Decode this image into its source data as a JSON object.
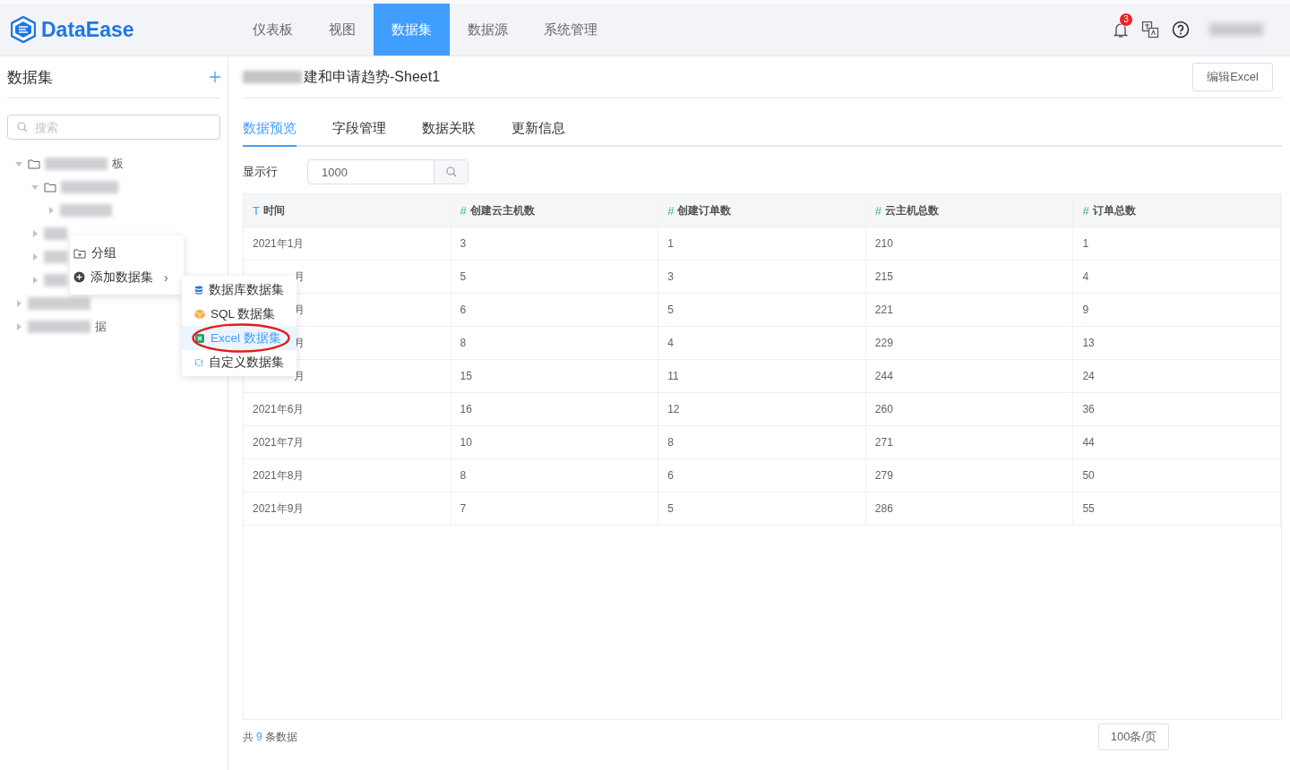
{
  "header": {
    "logo": "DataEase",
    "nav": [
      {
        "label": "仪表板",
        "selected": false
      },
      {
        "label": "视图",
        "selected": false
      },
      {
        "label": "数据集",
        "selected": true
      },
      {
        "label": "数据源",
        "selected": false
      },
      {
        "label": "系统管理",
        "selected": false
      }
    ],
    "notification_count": "3"
  },
  "sidebar": {
    "title": "数据集",
    "search": {
      "placeholder": "搜索"
    },
    "tree": [
      {
        "kind": "folder",
        "expanded": true,
        "label": "板",
        "children": [
          {
            "kind": "folder",
            "expanded": true,
            "children": [
              {
                "expanded": false
              }
            ]
          },
          {
            "expanded": false
          },
          {
            "expanded": false
          },
          {
            "expanded": false
          }
        ]
      },
      {
        "expanded": false
      },
      {
        "expanded": false,
        "label": "据"
      }
    ]
  },
  "context_menu": {
    "items": [
      {
        "kind": "group",
        "label": "分组"
      },
      {
        "kind": "add",
        "label": "添加数据集",
        "arrow": "›"
      }
    ],
    "submenu": [
      {
        "kind": "database",
        "label": "数据库数据集",
        "selected": false,
        "circled": false
      },
      {
        "kind": "sql",
        "label": "SQL 数据集",
        "selected": false,
        "circled": false
      },
      {
        "kind": "excel",
        "label": "Excel 数据集",
        "selected": true,
        "circled": true
      },
      {
        "kind": "custom",
        "label": "自定义数据集",
        "selected": false,
        "circled": false
      }
    ]
  },
  "main": {
    "title": "建和申请趋势-Sheet1",
    "edit_button": "编辑Excel",
    "tabs": [
      {
        "label": "数据预览",
        "selected": true
      },
      {
        "label": "字段管理",
        "selected": false
      },
      {
        "label": "数据关联",
        "selected": false
      },
      {
        "label": "更新信息",
        "selected": false
      }
    ],
    "row_limit": {
      "label": "显示行",
      "value": "1000"
    },
    "table": {
      "columns": [
        {
          "kind": "text",
          "mark": "T",
          "name": "时间"
        },
        {
          "kind": "number",
          "mark": "#",
          "name": "创建云主机数"
        },
        {
          "kind": "number",
          "mark": "#",
          "name": "创建订单数"
        },
        {
          "kind": "number",
          "mark": "#",
          "name": "云主机总数"
        },
        {
          "kind": "number",
          "mark": "#",
          "name": "订单总数"
        }
      ],
      "rows": [
        {
          "partial": false,
          "cells": [
            "2021年1月",
            "3",
            "1",
            "210",
            "1"
          ]
        },
        {
          "partial": true,
          "cells": [
            "月",
            "5",
            "3",
            "215",
            "4"
          ]
        },
        {
          "partial": true,
          "cells": [
            "月",
            "6",
            "5",
            "221",
            "9"
          ]
        },
        {
          "partial": true,
          "cells": [
            "月",
            "8",
            "4",
            "229",
            "13"
          ]
        },
        {
          "partial": true,
          "cells": [
            "月",
            "15",
            "11",
            "244",
            "24"
          ]
        },
        {
          "partial": false,
          "cells": [
            "2021年6月",
            "16",
            "12",
            "260",
            "36"
          ]
        },
        {
          "partial": false,
          "cells": [
            "2021年7月",
            "10",
            "8",
            "271",
            "44"
          ]
        },
        {
          "partial": false,
          "cells": [
            "2021年8月",
            "8",
            "6",
            "279",
            "50"
          ]
        },
        {
          "partial": false,
          "cells": [
            "2021年9月",
            "7",
            "5",
            "286",
            "55"
          ]
        }
      ]
    },
    "footer": {
      "total_prefix": "共",
      "total_count": "9",
      "total_suffix": "条数据",
      "page_size": "100条/页"
    }
  }
}
